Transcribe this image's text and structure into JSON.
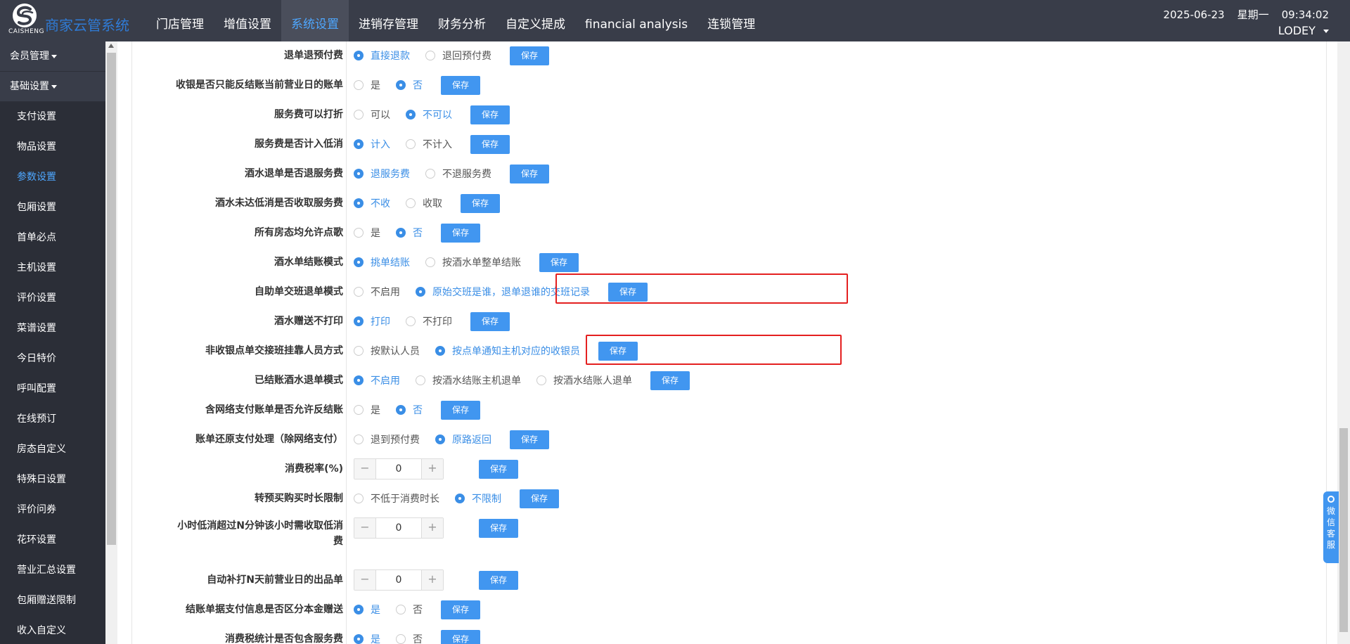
{
  "header": {
    "logo_text": "CAISHENG",
    "app_title": "商家云管系统",
    "nav": [
      {
        "label": "门店管理",
        "active": false
      },
      {
        "label": "增值设置",
        "active": false
      },
      {
        "label": "系统设置",
        "active": true
      },
      {
        "label": "进销存管理",
        "active": false
      },
      {
        "label": "财务分析",
        "active": false
      },
      {
        "label": "自定义提成",
        "active": false
      },
      {
        "label": "financial analysis",
        "active": false
      },
      {
        "label": "连锁管理",
        "active": false
      }
    ],
    "date": "2025-06-23",
    "weekday": "星期一",
    "time": "09:34:02",
    "user": "LODEY"
  },
  "sidebar": {
    "groups": [
      {
        "label": "会员管理"
      },
      {
        "label": "基础设置"
      }
    ],
    "items": [
      {
        "label": "支付设置"
      },
      {
        "label": "物品设置"
      },
      {
        "label": "参数设置",
        "active": true
      },
      {
        "label": "包厢设置"
      },
      {
        "label": "首单必点"
      },
      {
        "label": "主机设置"
      },
      {
        "label": "评价设置"
      },
      {
        "label": "菜谱设置"
      },
      {
        "label": "今日特价"
      },
      {
        "label": "呼叫配置"
      },
      {
        "label": "在线预订"
      },
      {
        "label": "房态自定义"
      },
      {
        "label": "特殊日设置"
      },
      {
        "label": "评价问券"
      },
      {
        "label": "花环设置"
      },
      {
        "label": "营业汇总设置"
      },
      {
        "label": "包厢赠送限制"
      },
      {
        "label": "收入自定义"
      }
    ]
  },
  "save_label": "保存",
  "settings": {
    "r0": {
      "label": "退单退预付费",
      "opts": [
        "直接退款",
        "退回预付费"
      ]
    },
    "r1": {
      "label": "收银是否只能反结账当前营业日的账单",
      "opts": [
        "是",
        "否"
      ]
    },
    "r2": {
      "label": "服务费可以打折",
      "opts": [
        "可以",
        "不可以"
      ]
    },
    "r3": {
      "label": "服务费是否计入低消",
      "opts": [
        "计入",
        "不计入"
      ]
    },
    "r4": {
      "label": "酒水退单是否退服务费",
      "opts": [
        "退服务费",
        "不退服务费"
      ]
    },
    "r5": {
      "label": "酒水未达低消是否收取服务费",
      "opts": [
        "不收",
        "收取"
      ]
    },
    "r6": {
      "label": "所有房态均允许点歌",
      "opts": [
        "是",
        "否"
      ]
    },
    "r7": {
      "label": "酒水单结账模式",
      "opts": [
        "挑单结账",
        "按酒水单整单结账"
      ]
    },
    "r8": {
      "label": "自助单交班退单模式",
      "opts": [
        "不启用",
        "原始交班是谁，退单退谁的交班记录"
      ]
    },
    "r9": {
      "label": "酒水赠送不打印",
      "opts": [
        "打印",
        "不打印"
      ]
    },
    "r10": {
      "label": "非收银点单交接班挂靠人员方式",
      "opts": [
        "按默认人员",
        "按点单通知主机对应的收银员"
      ]
    },
    "r11": {
      "label": "已结账酒水退单模式",
      "opts": [
        "不启用",
        "按酒水结账主机退单",
        "按酒水结账人退单"
      ]
    },
    "r12": {
      "label": "含网络支付账单是否允许反结账",
      "opts": [
        "是",
        "否"
      ]
    },
    "r13": {
      "label": "账单还原支付处理（除网络支付）",
      "opts": [
        "退到预付费",
        "原路返回"
      ]
    },
    "r14": {
      "label": "消费税率(%)",
      "value": "0"
    },
    "r15": {
      "label": "转预买购买时长限制",
      "opts": [
        "不低于消费时长",
        "不限制"
      ]
    },
    "r16": {
      "label": "小时低消超过N分钟该小时需收取低消费",
      "value": "0"
    },
    "r17": {
      "label": "自动补打N天前营业日的出品单",
      "value": "0"
    },
    "r18": {
      "label": "结账单据支付信息是否区分本金赠送",
      "opts": [
        "是",
        "否"
      ]
    },
    "r19": {
      "label": "消费税统计是否包含服务费",
      "opts": [
        "是",
        "否"
      ]
    }
  },
  "stepper": {
    "minus": "−",
    "plus": "+"
  },
  "service_tab": {
    "label": "微信客服"
  },
  "colors": {
    "accent": "#4196f0",
    "topbar": "#393d49",
    "highlight": "#e42020"
  }
}
